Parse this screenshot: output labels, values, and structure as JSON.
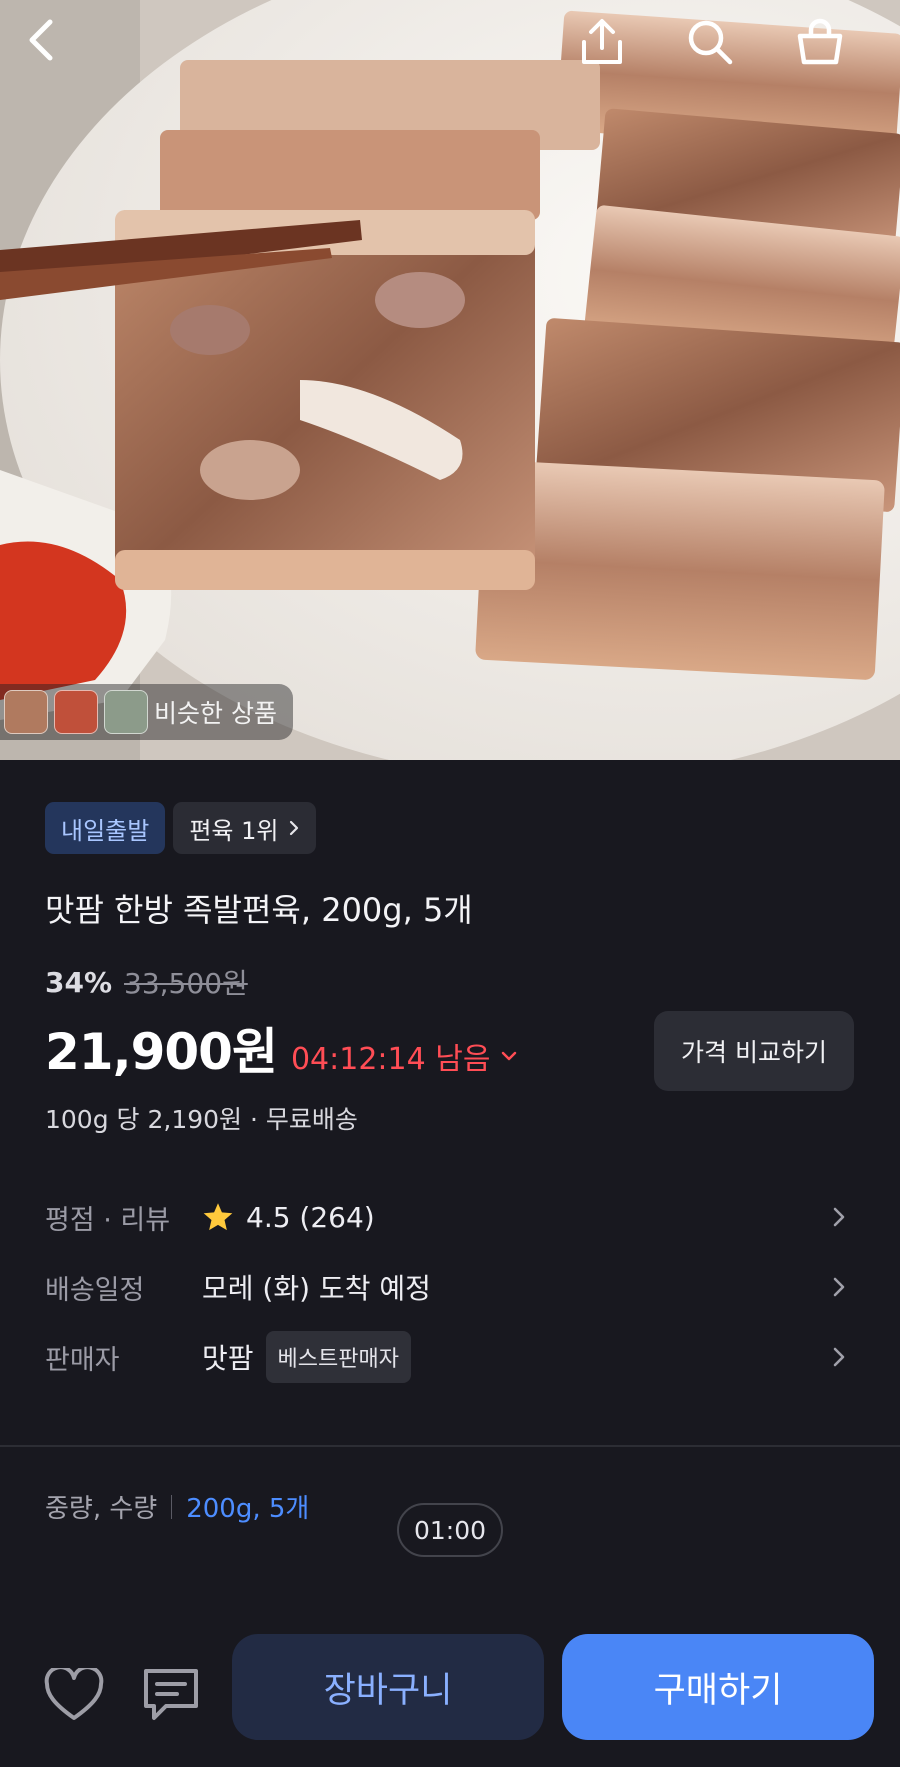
{
  "hero": {
    "similar_label": "비슷한 상품"
  },
  "badges": {
    "dispatch": "내일출발",
    "ranking": "편육 1위"
  },
  "product": {
    "title": "맛팜 한방 족발편육, 200g, 5개",
    "discount_percent": "34%",
    "original_price": "33,500원",
    "price": "21,900원",
    "timer": "04:12:14 남음",
    "compare_label": "가격 비교하기",
    "unit_price": "100g 당 2,190원 · 무료배송"
  },
  "details": {
    "rating_label": "평점 · 리뷰",
    "rating_value": "4.5 (264)",
    "delivery_label": "배송일정",
    "delivery_value": "모레 (화) 도착 예정",
    "seller_label": "판매자",
    "seller_value": "맛팜",
    "seller_badge": "베스트판매자"
  },
  "option": {
    "label": "중량, 수량",
    "value": "200g, 5개"
  },
  "overlay": {
    "time": "01:00"
  },
  "actions": {
    "cart_label": "장바구니",
    "buy_label": "구매하기"
  },
  "colors": {
    "background": "#18181f",
    "accent_blue": "#4a86f6",
    "timer_red": "#ff4d55",
    "star": "#ffc93c"
  }
}
